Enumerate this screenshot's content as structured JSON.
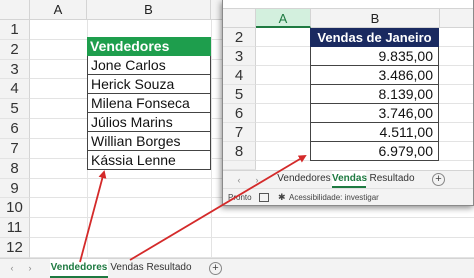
{
  "window_back": {
    "columns": [
      "A",
      "B"
    ],
    "rows": [
      "1",
      "2",
      "3",
      "4",
      "5",
      "6",
      "7",
      "8",
      "9",
      "10",
      "11",
      "12"
    ],
    "table": {
      "header": "Vendedores",
      "names": [
        "Jone Carlos",
        "Herick Souza",
        "Milena Fonseca",
        "Júlios Marins",
        "Willian Borges",
        "Kássia Lenne"
      ]
    },
    "sheet_tabs": [
      "Vendedores",
      "Vendas",
      "Resultado"
    ],
    "active_tab": "Vendedores",
    "nav_prev": "‹",
    "nav_next": "›",
    "add_sheet": "+"
  },
  "window_front": {
    "columns": [
      "A",
      "B"
    ],
    "rows": [
      "2",
      "3",
      "4",
      "5",
      "6",
      "7",
      "8"
    ],
    "table": {
      "header": "Vendas de Janeiro",
      "values": [
        "9.835,00",
        "3.486,00",
        "8.139,00",
        "3.746,00",
        "4.511,00",
        "6.979,00"
      ]
    },
    "sheet_tabs": [
      "Vendedores",
      "Vendas",
      "Resultado"
    ],
    "active_tab": "Vendas",
    "nav_prev": "‹",
    "nav_next": "›",
    "add_sheet": "+",
    "status": {
      "ready": "Pronto",
      "accessibility": "Acessibilidade: investigar"
    }
  },
  "colors": {
    "green_header": "#1e9e4d",
    "navy_header": "#1a2a60",
    "arrow": "#d42a2a",
    "active_tab": "#1e7a41"
  }
}
